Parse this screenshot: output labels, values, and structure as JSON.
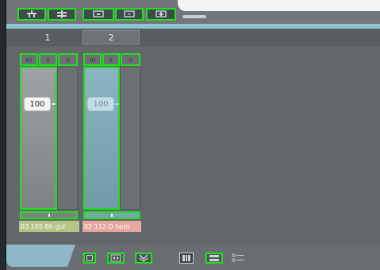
{
  "toolbar": {
    "buttons": [
      "group-icon",
      "strip-icon",
      "monitor-input-icon",
      "monitor-output-icon",
      "monitor-add-icon"
    ]
  },
  "tracks": [
    {
      "header": "1",
      "mute": "m",
      "solo": "s",
      "rec": "o",
      "volume": "100",
      "name": "03 105 Bb gui",
      "color": "#b6c486"
    },
    {
      "header": "2",
      "mute": "m",
      "solo": "s",
      "rec": "o",
      "volume": "100",
      "name": "02 112 D horn",
      "color": "#e6a7a0"
    }
  ],
  "bottom": {
    "buttons": [
      "square-icon",
      "expand-icon",
      "collapse-icon",
      "columns-icon",
      "rows-icon",
      "list-icon"
    ]
  }
}
